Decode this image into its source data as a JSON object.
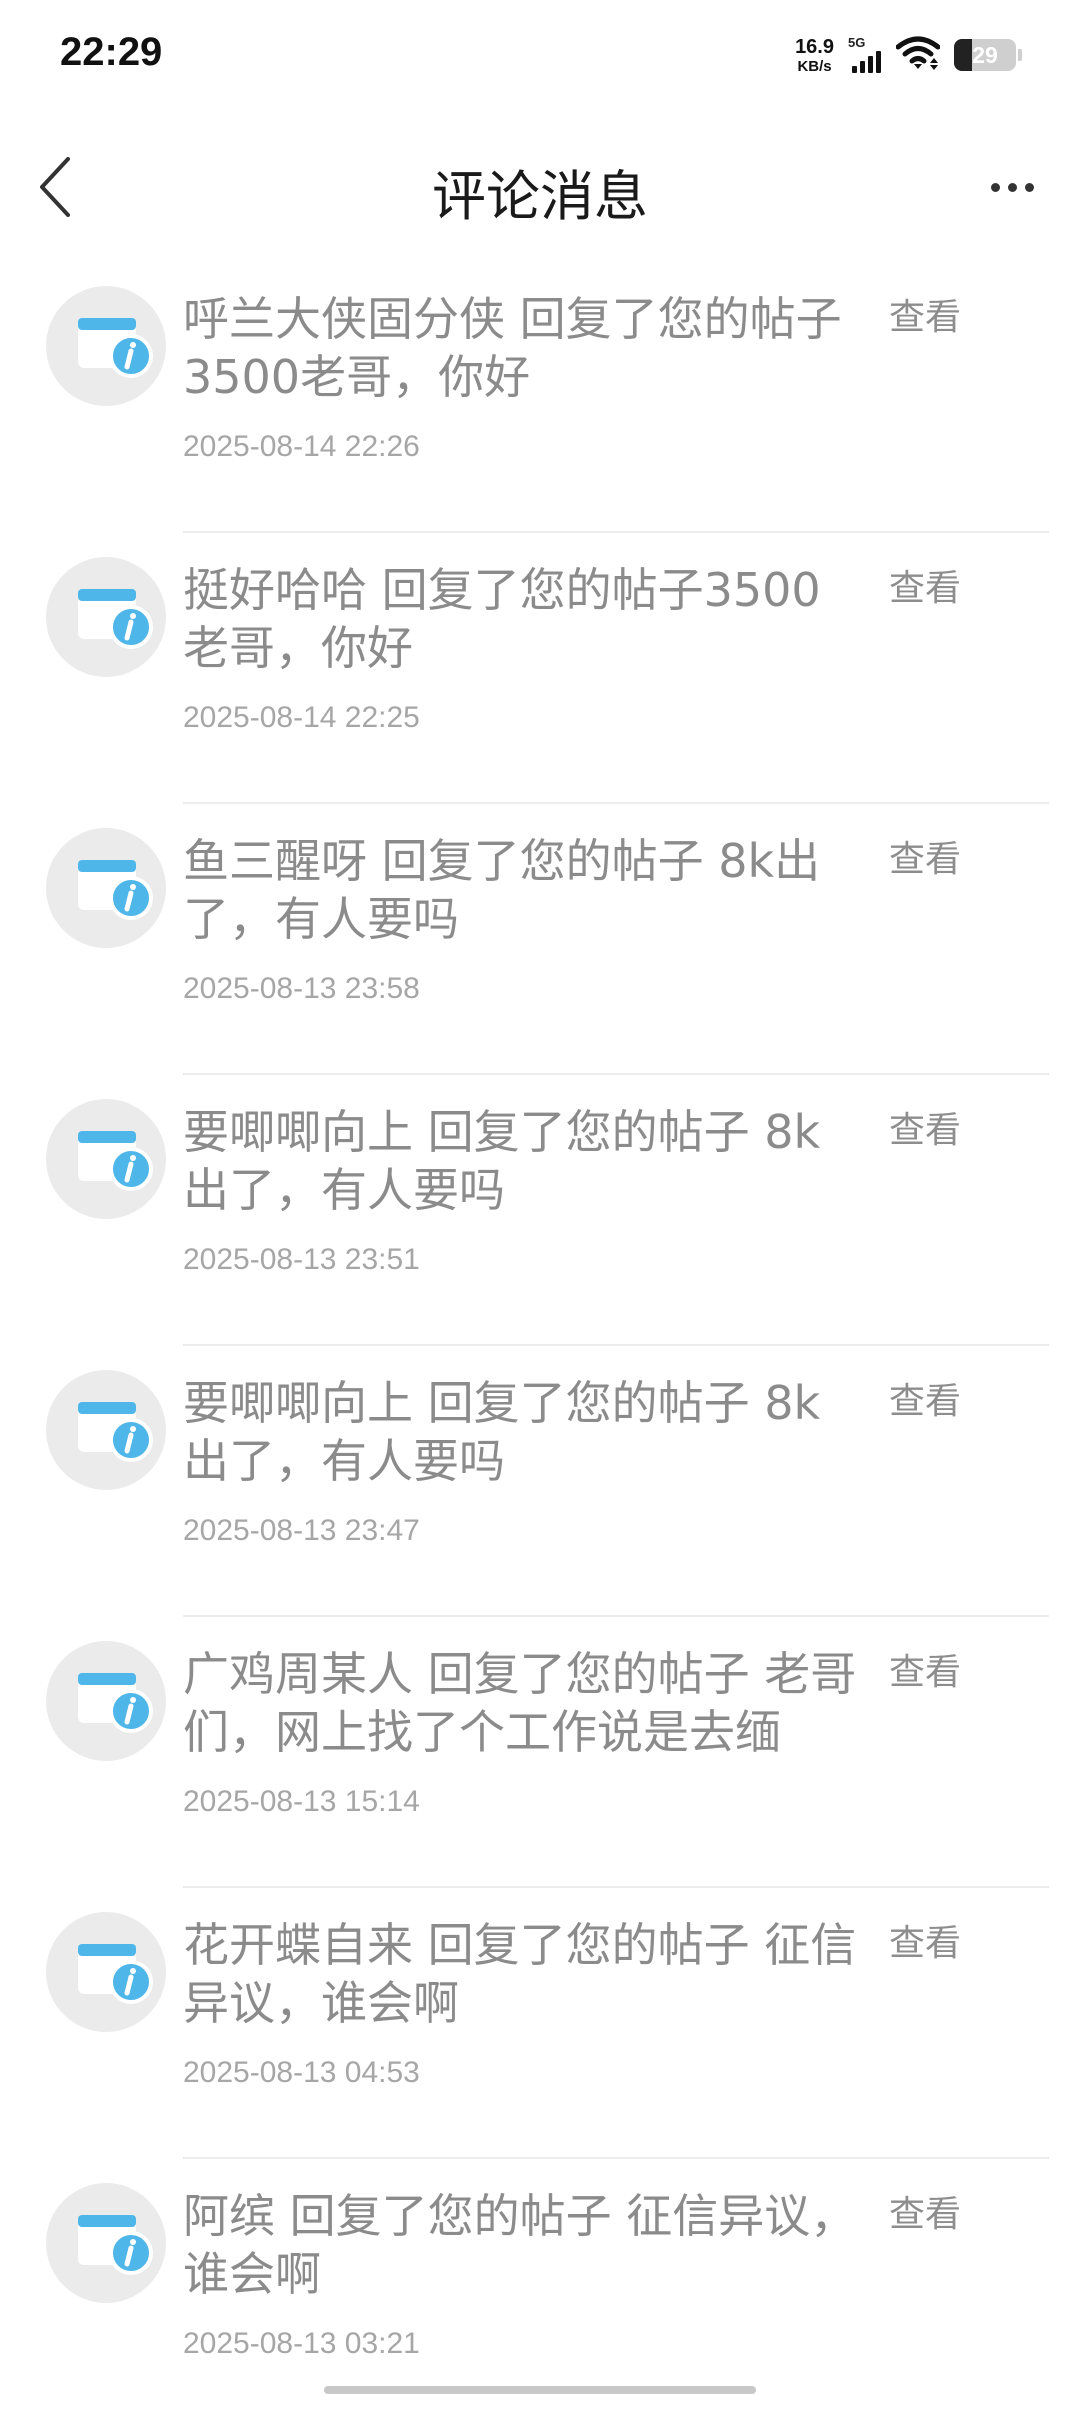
{
  "status_bar": {
    "time": "22:29",
    "net_speed_value": "16.9",
    "net_speed_unit": "KB/s",
    "network_type": "5G",
    "battery_level": "29",
    "battery_fraction": 0.29
  },
  "header": {
    "title": "评论消息",
    "back_icon": "chevron-left-icon",
    "more_icon": "more-dots-icon"
  },
  "messages": [
    {
      "text": "呼兰大侠固分侠 回复了您的帖子3500老哥，你好",
      "time": "2025-08-14 22:26",
      "action": "查看"
    },
    {
      "text": "挺好哈哈 回复了您的帖子3500老哥，你好",
      "time": "2025-08-14 22:25",
      "action": "查看"
    },
    {
      "text": "鱼三醒呀 回复了您的帖子 8k出了，有人要吗",
      "time": "2025-08-13 23:58",
      "action": "查看"
    },
    {
      "text": "要唧唧向上 回复了您的帖子 8k出了，有人要吗",
      "time": "2025-08-13 23:51",
      "action": "查看"
    },
    {
      "text": "要唧唧向上 回复了您的帖子 8k出了，有人要吗",
      "time": "2025-08-13 23:47",
      "action": "查看"
    },
    {
      "text": "广鸡周某人 回复了您的帖子 老哥们，网上找了个工作说是去缅",
      "time": "2025-08-13 15:14",
      "action": "查看"
    },
    {
      "text": "花开蝶自来 回复了您的帖子 征信异议，谁会啊",
      "time": "2025-08-13 04:53",
      "action": "查看"
    },
    {
      "text": "阿缤 回复了您的帖子 征信异议，谁会啊",
      "time": "2025-08-13 03:21",
      "action": "查看"
    }
  ],
  "colors": {
    "icon_blue": "#4fb6ea",
    "avatar_bg": "#ebebeb",
    "text_gray": "#8b8b8b"
  }
}
